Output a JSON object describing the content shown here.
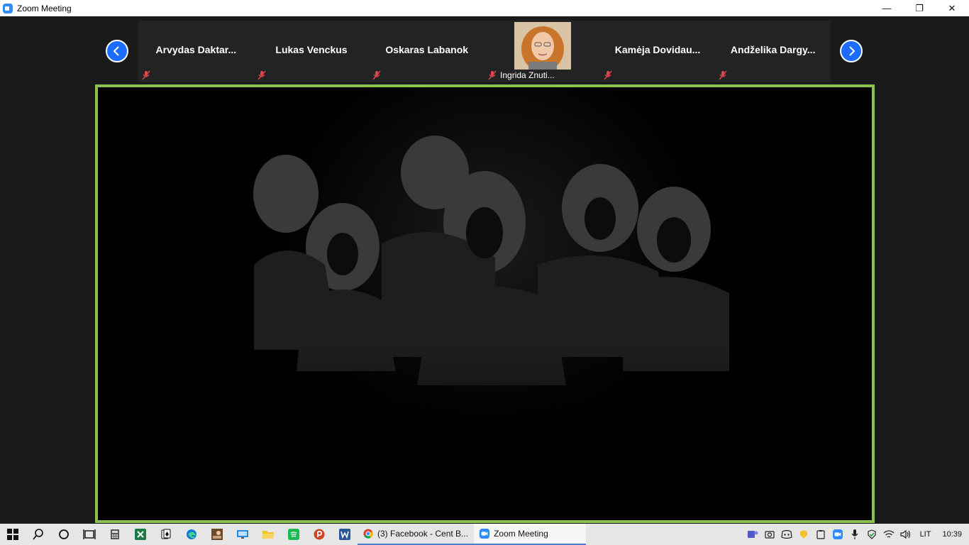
{
  "window": {
    "title": "Zoom Meeting"
  },
  "controls": {
    "minimize": "—",
    "restore": "❐",
    "close": "✕"
  },
  "participants": [
    {
      "name": "Arvydas  Daktar...",
      "muted": true
    },
    {
      "name": "Lukas Venckus",
      "muted": true
    },
    {
      "name": "Oskaras Labanok",
      "muted": true
    },
    {
      "name": "Ingrida Znuti...",
      "muted": true,
      "has_video": true
    },
    {
      "name": "Kamėja  Dovidau...",
      "muted": true
    },
    {
      "name": "Andželika  Dargy...",
      "muted": true
    }
  ],
  "taskbar": {
    "apps": [
      {
        "label": "(3) Facebook - Cent B..."
      },
      {
        "label": "Zoom Meeting"
      }
    ],
    "tray": {
      "language": "LIT",
      "time": "10:39"
    }
  },
  "colors": {
    "speaker_border": "#8bc34a",
    "nav_arrow": "#1a6dff",
    "muted_icon": "#e0474c"
  }
}
